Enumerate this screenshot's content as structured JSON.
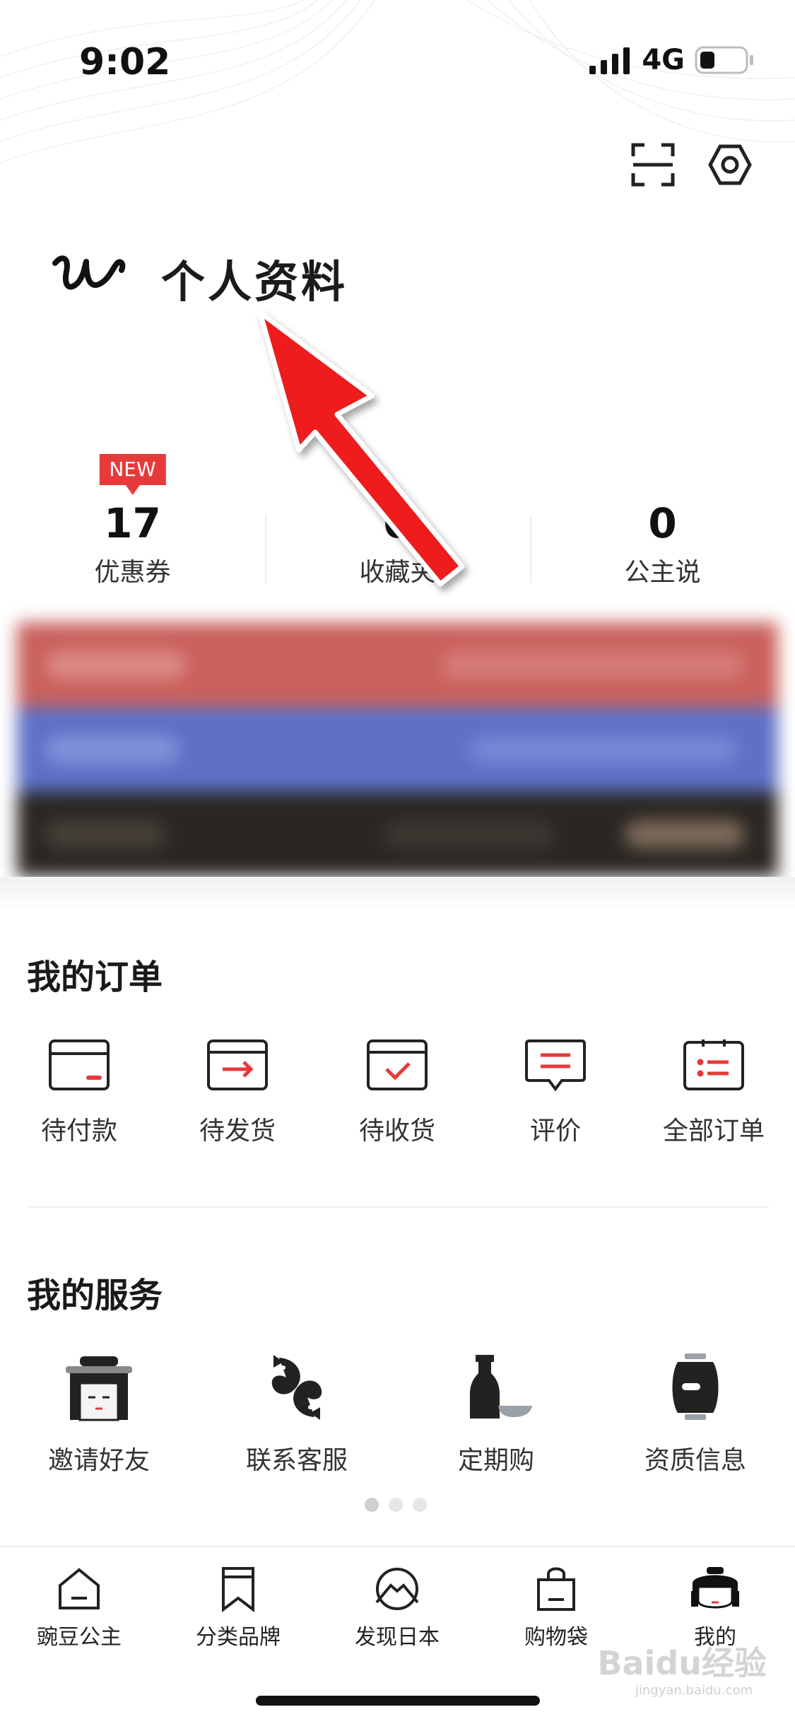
{
  "status_bar": {
    "time": "9:02",
    "network": "4G"
  },
  "header": {
    "scan_icon": "scan-icon",
    "settings_icon": "settings-hexagon-icon"
  },
  "profile": {
    "logo_icon": "brand-w-logo",
    "title": "个人资料"
  },
  "stats": [
    {
      "value": "17",
      "label": "优惠券",
      "badge": "NEW"
    },
    {
      "value": "0",
      "label": "收藏夹"
    },
    {
      "value": "0",
      "label": "公主说"
    }
  ],
  "orders": {
    "title": "我的订单",
    "items": [
      {
        "label": "待付款",
        "icon": "wallet-icon"
      },
      {
        "label": "待发货",
        "icon": "box-arrow-icon"
      },
      {
        "label": "待收货",
        "icon": "box-check-icon"
      },
      {
        "label": "评价",
        "icon": "comment-icon"
      },
      {
        "label": "全部订单",
        "icon": "clipboard-list-icon"
      }
    ]
  },
  "services": {
    "title": "我的服务",
    "items": [
      {
        "label": "邀请好友",
        "icon": "geisha-icon"
      },
      {
        "label": "联系客服",
        "icon": "koi-fish-icon"
      },
      {
        "label": "定期购",
        "icon": "soy-sauce-icon"
      },
      {
        "label": "资质信息",
        "icon": "lantern-icon"
      }
    ],
    "pager_pages": 3,
    "pager_active": 0
  },
  "tabbar": {
    "items": [
      {
        "label": "豌豆公主",
        "icon": "home-icon"
      },
      {
        "label": "分类品牌",
        "icon": "bookmark-icon"
      },
      {
        "label": "发现日本",
        "icon": "mount-fuji-icon"
      },
      {
        "label": "购物袋",
        "icon": "shopping-bag-icon"
      },
      {
        "label": "我的",
        "icon": "princess-avatar-icon"
      }
    ],
    "active_index": 4
  },
  "watermark": {
    "text": "Baidu经验",
    "sub": "jingyan.baidu.com"
  },
  "colors": {
    "accent_red": "#e63a3a",
    "card_red": "#c9605c",
    "card_blue": "#5d70c6",
    "card_dark": "#2a2622",
    "icon_dark": "#222222"
  }
}
